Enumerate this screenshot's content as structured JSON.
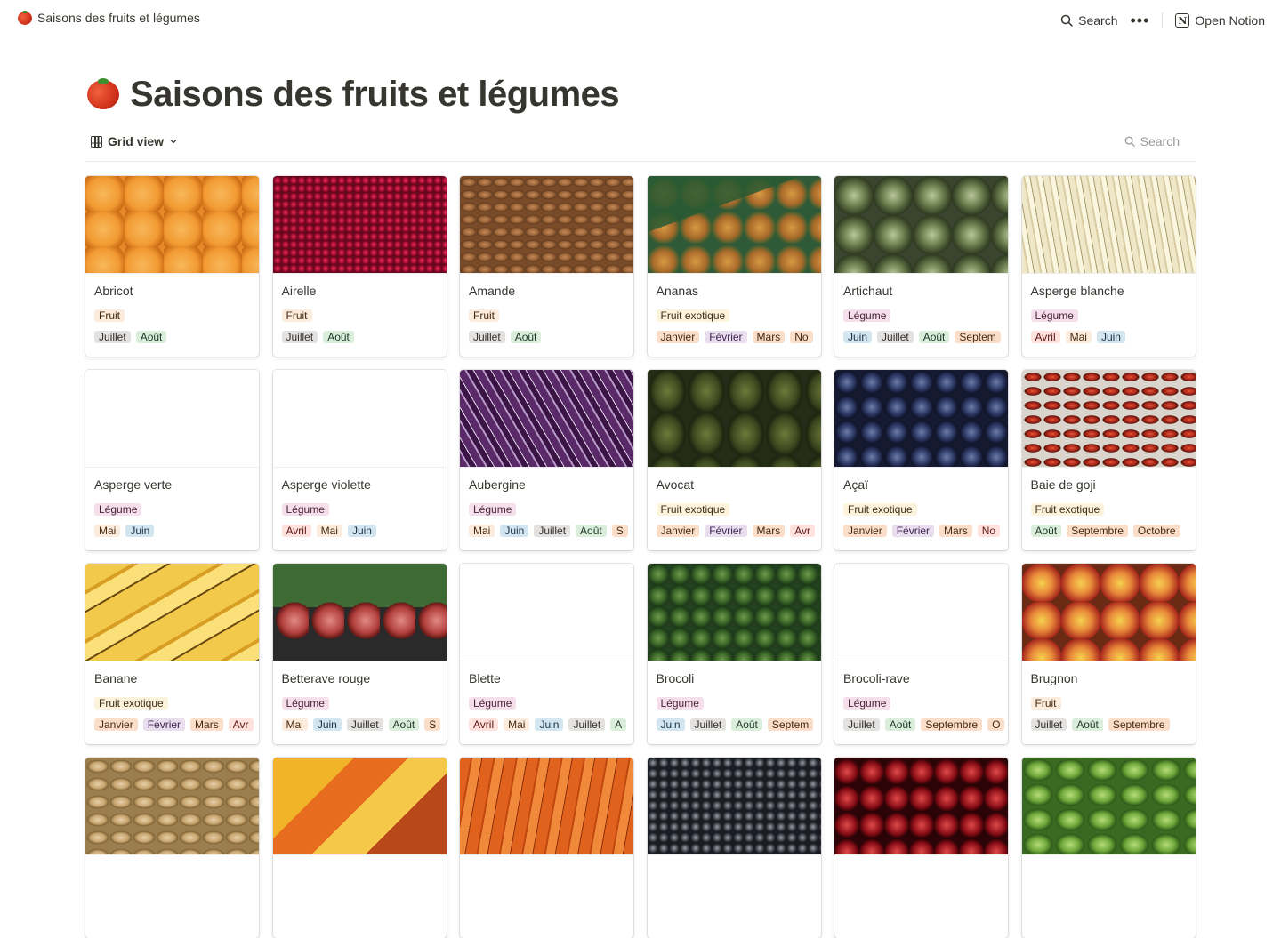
{
  "topbar": {
    "page_title": "Saisons des fruits et légumes",
    "search_label": "Search",
    "more_label": "•••",
    "open_notion_label": "Open Notion",
    "notion_glyph": "N"
  },
  "page": {
    "title": "Saisons des fruits et légumes",
    "icon": "tomato-icon"
  },
  "viewbar": {
    "view_label": "Grid view",
    "search_label": "Search"
  },
  "colors": {
    "fruit": "#fbecdd",
    "fruit_exotique": "#fbf3db",
    "legume": "#f4dfeb",
    "juillet": "#e3e2e0",
    "aout": "#dbeddb",
    "janvier": "#fadec9",
    "fevrier": "#e8deee",
    "mars": "#fadec9",
    "juin": "#d3e5ef"
  },
  "cards": [
    {
      "name": "Abricot",
      "cover": "c-apricot",
      "type": "Fruit",
      "type_class": "t-fruit",
      "months": [
        [
          "Juillet",
          "t-gray"
        ],
        [
          "Août",
          "t-green"
        ]
      ]
    },
    {
      "name": "Airelle",
      "cover": "c-airelle",
      "type": "Fruit",
      "type_class": "t-fruit",
      "months": [
        [
          "Juillet",
          "t-gray"
        ],
        [
          "Août",
          "t-green"
        ]
      ]
    },
    {
      "name": "Amande",
      "cover": "c-amande",
      "type": "Fruit",
      "type_class": "t-fruit",
      "months": [
        [
          "Juillet",
          "t-gray"
        ],
        [
          "Août",
          "t-green"
        ]
      ]
    },
    {
      "name": "Ananas",
      "cover": "c-ananas",
      "type": "Fruit exotique",
      "type_class": "t-exo",
      "months": [
        [
          "Janvier",
          "t-orange"
        ],
        [
          "Février",
          "t-purple"
        ],
        [
          "Mars",
          "t-orange"
        ],
        [
          "No",
          "t-orange"
        ]
      ]
    },
    {
      "name": "Artichaut",
      "cover": "c-artichaut",
      "type": "Légume",
      "type_class": "t-leg",
      "months": [
        [
          "Juin",
          "t-blue"
        ],
        [
          "Juillet",
          "t-gray"
        ],
        [
          "Août",
          "t-green"
        ],
        [
          "Septem",
          "t-orange"
        ]
      ]
    },
    {
      "name": "Asperge blanche",
      "cover": "c-asperge",
      "type": "Légume",
      "type_class": "t-leg",
      "months": [
        [
          "Avril",
          "t-red"
        ],
        [
          "Mai",
          "t-yellow"
        ],
        [
          "Juin",
          "t-blue"
        ]
      ]
    },
    {
      "name": "Asperge verte",
      "cover": "c-empty",
      "type": "Légume",
      "type_class": "t-leg",
      "months": [
        [
          "Mai",
          "t-yellow"
        ],
        [
          "Juin",
          "t-blue"
        ]
      ]
    },
    {
      "name": "Asperge violette",
      "cover": "c-empty",
      "type": "Légume",
      "type_class": "t-leg",
      "months": [
        [
          "Avril",
          "t-red"
        ],
        [
          "Mai",
          "t-yellow"
        ],
        [
          "Juin",
          "t-blue"
        ]
      ]
    },
    {
      "name": "Aubergine",
      "cover": "c-aubergine",
      "type": "Légume",
      "type_class": "t-leg",
      "months": [
        [
          "Mai",
          "t-yellow"
        ],
        [
          "Juin",
          "t-blue"
        ],
        [
          "Juillet",
          "t-gray"
        ],
        [
          "Août",
          "t-green"
        ],
        [
          "S",
          "t-orange"
        ]
      ]
    },
    {
      "name": "Avocat",
      "cover": "c-avocat",
      "type": "Fruit exotique",
      "type_class": "t-exo",
      "months": [
        [
          "Janvier",
          "t-orange"
        ],
        [
          "Février",
          "t-purple"
        ],
        [
          "Mars",
          "t-orange"
        ],
        [
          "Avr",
          "t-red"
        ]
      ]
    },
    {
      "name": "Açaï",
      "cover": "c-acai",
      "type": "Fruit exotique",
      "type_class": "t-exo",
      "months": [
        [
          "Janvier",
          "t-orange"
        ],
        [
          "Février",
          "t-purple"
        ],
        [
          "Mars",
          "t-orange"
        ],
        [
          "No",
          "t-red"
        ]
      ]
    },
    {
      "name": "Baie de goji",
      "cover": "c-goji",
      "type": "Fruit exotique",
      "type_class": "t-exo",
      "months": [
        [
          "Août",
          "t-green"
        ],
        [
          "Septembre",
          "t-orange"
        ],
        [
          "Octobre",
          "t-orange"
        ]
      ]
    },
    {
      "name": "Banane",
      "cover": "c-banane",
      "type": "Fruit exotique",
      "type_class": "t-exo",
      "months": [
        [
          "Janvier",
          "t-orange"
        ],
        [
          "Février",
          "t-purple"
        ],
        [
          "Mars",
          "t-orange"
        ],
        [
          "Avr",
          "t-red"
        ]
      ]
    },
    {
      "name": "Betterave rouge",
      "cover": "c-betterave",
      "type": "Légume",
      "type_class": "t-leg",
      "months": [
        [
          "Mai",
          "t-yellow"
        ],
        [
          "Juin",
          "t-blue"
        ],
        [
          "Juillet",
          "t-gray"
        ],
        [
          "Août",
          "t-green"
        ],
        [
          "S",
          "t-orange"
        ]
      ]
    },
    {
      "name": "Blette",
      "cover": "c-empty",
      "type": "Légume",
      "type_class": "t-leg",
      "months": [
        [
          "Avril",
          "t-red"
        ],
        [
          "Mai",
          "t-yellow"
        ],
        [
          "Juin",
          "t-blue"
        ],
        [
          "Juillet",
          "t-gray"
        ],
        [
          "A",
          "t-green"
        ]
      ]
    },
    {
      "name": "Brocoli",
      "cover": "c-brocoli",
      "type": "Légume",
      "type_class": "t-leg",
      "months": [
        [
          "Juin",
          "t-blue"
        ],
        [
          "Juillet",
          "t-gray"
        ],
        [
          "Août",
          "t-green"
        ],
        [
          "Septem",
          "t-orange"
        ]
      ]
    },
    {
      "name": "Brocoli-rave",
      "cover": "c-empty",
      "type": "Légume",
      "type_class": "t-leg",
      "months": [
        [
          "Juillet",
          "t-gray"
        ],
        [
          "Août",
          "t-green"
        ],
        [
          "Septembre",
          "t-orange"
        ],
        [
          "O",
          "t-orange"
        ]
      ]
    },
    {
      "name": "Brugnon",
      "cover": "c-brugnon",
      "type": "Fruit",
      "type_class": "t-fruit",
      "months": [
        [
          "Juillet",
          "t-gray"
        ],
        [
          "Août",
          "t-green"
        ],
        [
          "Septembre",
          "t-orange"
        ]
      ]
    },
    {
      "name": "",
      "cover": "c-cacahuete",
      "type": "",
      "type_class": "",
      "months": []
    },
    {
      "name": "",
      "cover": "c-mangue",
      "type": "",
      "type_class": "",
      "months": []
    },
    {
      "name": "",
      "cover": "c-carotte",
      "type": "",
      "type_class": "",
      "months": []
    },
    {
      "name": "",
      "cover": "c-cassis",
      "type": "",
      "type_class": "",
      "months": []
    },
    {
      "name": "",
      "cover": "c-cerise",
      "type": "",
      "type_class": "",
      "months": []
    },
    {
      "name": "",
      "cover": "c-chayote",
      "type": "",
      "type_class": "",
      "months": []
    }
  ]
}
